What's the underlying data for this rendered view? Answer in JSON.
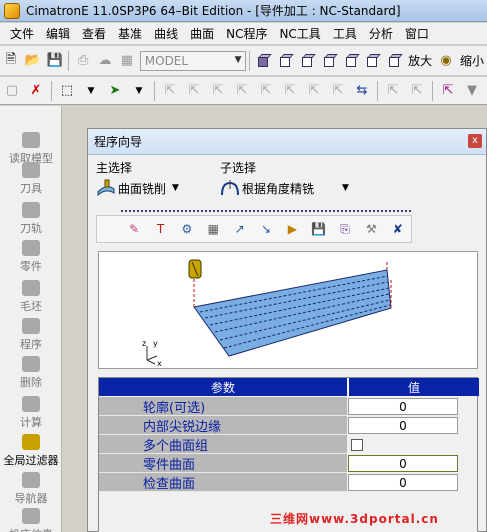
{
  "window": {
    "title": "CimatronE 11.0SP3P6 64–Bit Edition - [导件加工 : NC-Standard]"
  },
  "menu": [
    "文件",
    "编辑",
    "查看",
    "基准",
    "曲线",
    "曲面",
    "NC程序",
    "NC工具",
    "工具",
    "分析",
    "窗口"
  ],
  "toolbar1": {
    "model_combo": "MODEL",
    "zoom_in": "放大",
    "zoom_out": "缩小"
  },
  "sidebar": {
    "items": [
      {
        "label": "读取模型",
        "icon": "load-model-icon",
        "active": false
      },
      {
        "label": "刀具",
        "icon": "tool-icon",
        "active": false
      },
      {
        "label": "刀轨",
        "icon": "toolpath-icon",
        "active": false
      },
      {
        "label": "零件",
        "icon": "part-icon",
        "active": false
      },
      {
        "label": "毛坯",
        "icon": "stock-icon",
        "active": false
      },
      {
        "label": "程序",
        "icon": "program-icon",
        "active": false
      },
      {
        "label": "删除",
        "icon": "delete-icon",
        "active": false
      },
      {
        "label": "计算",
        "icon": "compute-icon",
        "active": false
      },
      {
        "label": "全局过滤器",
        "icon": "global-filter-icon",
        "active": true
      },
      {
        "label": "导航器",
        "icon": "navigator-icon",
        "active": false
      },
      {
        "label": "机床仿真",
        "icon": "machine-sim-icon",
        "active": false
      }
    ]
  },
  "dialog": {
    "title": "程序向导",
    "close": "x",
    "main_select_label": "主选择",
    "main_select_value": "曲面铣削",
    "sub_select_label": "子选择",
    "sub_select_value": "根据角度精铣",
    "preview_axes": {
      "z": "z",
      "y": "y",
      "x": "x"
    },
    "params": {
      "header_name": "参数",
      "header_value": "值",
      "rows": [
        {
          "name": "轮廓(可选)",
          "value": "0",
          "type": "number"
        },
        {
          "name": "内部尖锐边缘",
          "value": "0",
          "type": "number"
        },
        {
          "name": "多个曲面组",
          "value": "",
          "type": "checkbox"
        },
        {
          "name": "零件曲面",
          "value": "0",
          "type": "number"
        },
        {
          "name": "检查曲面",
          "value": "0",
          "type": "number"
        }
      ]
    }
  },
  "watermark": "三维网www.3dportal.cn"
}
